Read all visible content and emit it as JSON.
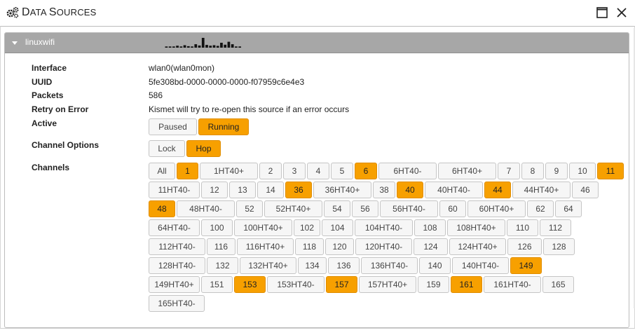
{
  "window": {
    "title_first": "D",
    "title_rest_1": "ata ",
    "title_second": "S",
    "title_rest_2": "ources",
    "icon": "gears-icon",
    "maximize_icon": "maximize-icon",
    "close_icon": "close-icon"
  },
  "source": {
    "name": "linuxwifi",
    "activity": [
      0.12,
      0.12,
      0.12,
      0.2,
      0.12,
      0.25,
      0.15,
      0.12,
      0.35,
      0.22,
      1.0,
      0.28,
      0.2,
      0.25,
      0.18,
      0.5,
      0.3,
      0.6,
      0.35,
      0.12,
      0.12
    ],
    "fields": [
      {
        "label": "Interface",
        "value": "wlan0(wlan0mon)"
      },
      {
        "label": "UUID",
        "value": "5fe308bd-0000-0000-0000-f07959c6e4e3"
      },
      {
        "label": "Packets",
        "value": "586"
      },
      {
        "label": "Retry on Error",
        "value": "Kismet will try to re-open this source if an error occurs"
      }
    ],
    "active_label": "Active",
    "paused_label": "Paused",
    "running_label": "Running",
    "active_state": "running",
    "channel_options_label": "Channel Options",
    "lock_label": "Lock",
    "hop_label": "Hop",
    "channel_mode": "hop",
    "channels_label": "Channels",
    "channels": [
      {
        "label": "All",
        "on": false
      },
      {
        "label": "1",
        "on": true
      },
      {
        "label": "1HT40+",
        "on": false
      },
      {
        "label": "2",
        "on": false
      },
      {
        "label": "3",
        "on": false
      },
      {
        "label": "4",
        "on": false
      },
      {
        "label": "5",
        "on": false
      },
      {
        "label": "6",
        "on": true
      },
      {
        "label": "6HT40-",
        "on": false
      },
      {
        "label": "6HT40+",
        "on": false
      },
      {
        "label": "7",
        "on": false
      },
      {
        "label": "8",
        "on": false
      },
      {
        "label": "9",
        "on": false
      },
      {
        "label": "10",
        "on": false
      },
      {
        "label": "11",
        "on": true
      },
      {
        "label": "11HT40-",
        "on": false
      },
      {
        "label": "12",
        "on": false
      },
      {
        "label": "13",
        "on": false
      },
      {
        "label": "14",
        "on": false
      },
      {
        "label": "36",
        "on": true
      },
      {
        "label": "36HT40+",
        "on": false
      },
      {
        "label": "38",
        "on": false
      },
      {
        "label": "40",
        "on": true
      },
      {
        "label": "40HT40-",
        "on": false
      },
      {
        "label": "44",
        "on": true
      },
      {
        "label": "44HT40+",
        "on": false
      },
      {
        "label": "46",
        "on": false
      },
      {
        "label": "48",
        "on": true
      },
      {
        "label": "48HT40-",
        "on": false
      },
      {
        "label": "52",
        "on": false
      },
      {
        "label": "52HT40+",
        "on": false
      },
      {
        "label": "54",
        "on": false
      },
      {
        "label": "56",
        "on": false
      },
      {
        "label": "56HT40-",
        "on": false
      },
      {
        "label": "60",
        "on": false
      },
      {
        "label": "60HT40+",
        "on": false
      },
      {
        "label": "62",
        "on": false
      },
      {
        "label": "64",
        "on": false
      },
      {
        "label": "64HT40-",
        "on": false
      },
      {
        "label": "100",
        "on": false
      },
      {
        "label": "100HT40+",
        "on": false
      },
      {
        "label": "102",
        "on": false
      },
      {
        "label": "104",
        "on": false
      },
      {
        "label": "104HT40-",
        "on": false
      },
      {
        "label": "108",
        "on": false
      },
      {
        "label": "108HT40+",
        "on": false
      },
      {
        "label": "110",
        "on": false
      },
      {
        "label": "112",
        "on": false
      },
      {
        "label": "112HT40-",
        "on": false
      },
      {
        "label": "116",
        "on": false
      },
      {
        "label": "116HT40+",
        "on": false
      },
      {
        "label": "118",
        "on": false
      },
      {
        "label": "120",
        "on": false
      },
      {
        "label": "120HT40-",
        "on": false
      },
      {
        "label": "124",
        "on": false
      },
      {
        "label": "124HT40+",
        "on": false
      },
      {
        "label": "126",
        "on": false
      },
      {
        "label": "128",
        "on": false
      },
      {
        "label": "128HT40-",
        "on": false
      },
      {
        "label": "132",
        "on": false
      },
      {
        "label": "132HT40+",
        "on": false
      },
      {
        "label": "134",
        "on": false
      },
      {
        "label": "136",
        "on": false
      },
      {
        "label": "136HT40-",
        "on": false
      },
      {
        "label": "140",
        "on": false
      },
      {
        "label": "140HT40-",
        "on": false
      },
      {
        "label": "149",
        "on": true
      },
      {
        "label": "149HT40+",
        "on": false
      },
      {
        "label": "151",
        "on": false
      },
      {
        "label": "153",
        "on": true
      },
      {
        "label": "153HT40-",
        "on": false
      },
      {
        "label": "157",
        "on": true
      },
      {
        "label": "157HT40+",
        "on": false
      },
      {
        "label": "159",
        "on": false
      },
      {
        "label": "161",
        "on": true
      },
      {
        "label": "161HT40-",
        "on": false
      },
      {
        "label": "165",
        "on": false
      },
      {
        "label": "165HT40-",
        "on": false
      }
    ]
  },
  "colors": {
    "active": "#f7a000",
    "inactive": "#f6f6f6",
    "header": "#a7a7a7"
  }
}
